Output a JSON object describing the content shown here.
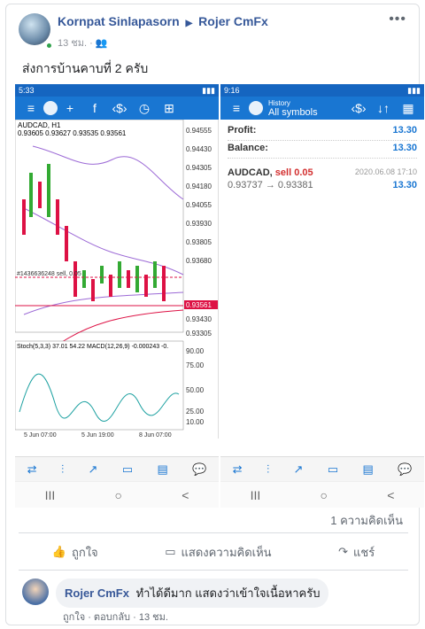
{
  "post": {
    "author": "Kornpat Sinlapasorn",
    "target": "Rojer CmFx",
    "time": "13 ชม. · ",
    "more_icon": "ellipsis-icon",
    "text": "ส่งการบ้านคาบที่ 2 ครับ"
  },
  "screenshot": {
    "left_status_time": "5:33",
    "right_status_time": "9:16",
    "left_toolbar": [
      "+",
      "f",
      "‹$›",
      "◷",
      "⊞"
    ],
    "right_title_small": "History",
    "right_title": "All symbols",
    "chart_label": "AUDCAD, H1",
    "chart_ohlc": "0.93605 0.93627 0.93535 0.93561",
    "price_ticks": [
      "0.94555",
      "0.94430",
      "0.94305",
      "0.94180",
      "0.94055",
      "0.93930",
      "0.93805",
      "0.93680",
      "0.93561",
      "0.93430",
      "0.93305"
    ],
    "order_line_label": "#1436636248 sell, 0.05",
    "osc_label": "Stoch(5,3,3) 37.01 54.22 MACD(12,26,9) -0.000243 -0.",
    "osc_ticks": [
      "90.00",
      "75.00",
      "50.00",
      "25.00",
      "10.00"
    ],
    "time_labels": [
      "5 Jun 07:00",
      "5 Jun 19:00",
      "8 Jun 07:00"
    ],
    "history": {
      "profit_label": "Profit:",
      "profit_value": "13.30",
      "balance_label": "Balance:",
      "balance_value": "13.30",
      "trade_symbol": "AUDCAD,",
      "trade_side": "sell 0.05",
      "trade_date": "2020.06.08 17:10",
      "trade_prices": "0.93737 → 0.93381",
      "trade_profit": "13.30"
    },
    "sys_nav": [
      "III",
      "○",
      "<"
    ]
  },
  "footer": {
    "comment_count": "1 ความคิดเห็น",
    "like": "ถูกใจ",
    "comment": "แสดงความคิดเห็น",
    "share": "แชร์"
  },
  "comment": {
    "author": "Rojer CmFx",
    "text": "ทำได้ดีมาก แสดงว่าเข้าใจเนื้อหาครับ",
    "like_link": "ถูกใจ",
    "reply_link": "ตอบกลับ",
    "time": "13 ชม."
  }
}
